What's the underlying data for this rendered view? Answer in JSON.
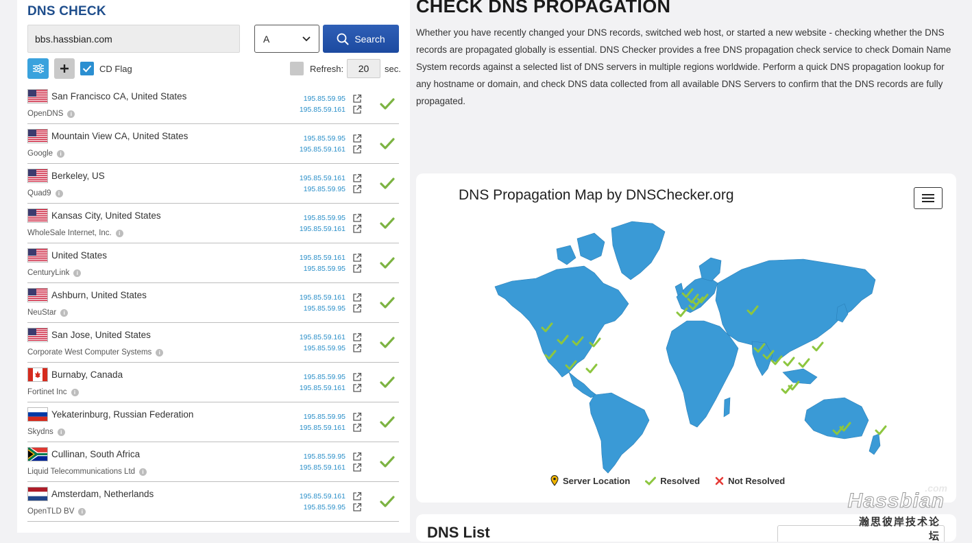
{
  "left": {
    "title": "DNS CHECK",
    "domain_value": "bbs.hassbian.com",
    "record_type": "A",
    "search_label": "Search",
    "cd_flag_label": "CD Flag",
    "cd_flag_checked": true,
    "refresh_label": "Refresh:",
    "refresh_value": "20",
    "refresh_unit": "sec."
  },
  "servers": [
    {
      "flag": "us",
      "location": "San Francisco CA, United States",
      "provider": "OpenDNS",
      "ips": [
        "195.85.59.95",
        "195.85.59.161"
      ],
      "status": "resolved"
    },
    {
      "flag": "us",
      "location": "Mountain View CA, United States",
      "provider": "Google",
      "ips": [
        "195.85.59.95",
        "195.85.59.161"
      ],
      "status": "resolved"
    },
    {
      "flag": "us",
      "location": "Berkeley, US",
      "provider": "Quad9",
      "ips": [
        "195.85.59.161",
        "195.85.59.95"
      ],
      "status": "resolved"
    },
    {
      "flag": "us",
      "location": "Kansas City, United States",
      "provider": "WholeSale Internet, Inc.",
      "ips": [
        "195.85.59.95",
        "195.85.59.161"
      ],
      "status": "resolved"
    },
    {
      "flag": "us",
      "location": "United States",
      "provider": "CenturyLink",
      "ips": [
        "195.85.59.161",
        "195.85.59.95"
      ],
      "status": "resolved"
    },
    {
      "flag": "us",
      "location": "Ashburn, United States",
      "provider": "NeuStar",
      "ips": [
        "195.85.59.161",
        "195.85.59.95"
      ],
      "status": "resolved"
    },
    {
      "flag": "us",
      "location": "San Jose, United States",
      "provider": "Corporate West Computer Systems",
      "ips": [
        "195.85.59.161",
        "195.85.59.95"
      ],
      "status": "resolved"
    },
    {
      "flag": "ca",
      "location": "Burnaby, Canada",
      "provider": "Fortinet Inc",
      "ips": [
        "195.85.59.95",
        "195.85.59.161"
      ],
      "status": "resolved"
    },
    {
      "flag": "ru",
      "location": "Yekaterinburg, Russian Federation",
      "provider": "Skydns",
      "ips": [
        "195.85.59.95",
        "195.85.59.161"
      ],
      "status": "resolved"
    },
    {
      "flag": "za",
      "location": "Cullinan, South Africa",
      "provider": "Liquid Telecommunications Ltd",
      "ips": [
        "195.85.59.95",
        "195.85.59.161"
      ],
      "status": "resolved"
    },
    {
      "flag": "nl",
      "location": "Amsterdam, Netherlands",
      "provider": "OpenTLD BV",
      "ips": [
        "195.85.59.161",
        "195.85.59.95"
      ],
      "status": "resolved"
    }
  ],
  "main": {
    "title": "CHECK DNS PROPAGATION",
    "intro": "Whether you have recently changed your DNS records, switched web host, or started a new website - checking whether the DNS records are propagated globally is essential. DNS Checker provides a free DNS propagation check service to check Domain Name System records against a selected list of DNS servers in multiple regions worldwide. Perform a quick DNS propagation lookup for any hostname or domain, and check DNS data collected from all available DNS Servers to confirm that the DNS records are fully propagated."
  },
  "map": {
    "title": "DNS Propagation Map by DNSChecker.org",
    "legend": {
      "server_location": "Server Location",
      "resolved": "Resolved",
      "not_resolved": "Not Resolved"
    }
  },
  "list": {
    "title": "DNS List"
  },
  "watermark": {
    "com": ".com",
    "brand": "Hassbian",
    "sub": "瀚思彼岸技术论坛"
  },
  "colors": {
    "brand_blue": "#1f4e8c",
    "search_button": "#2556ac",
    "ip_link": "#2a8fc9",
    "map_land": "#3a9ad6",
    "resolved_check": "#8dc63f",
    "not_resolved": "#e53935",
    "server_pin": "#f0b400"
  }
}
